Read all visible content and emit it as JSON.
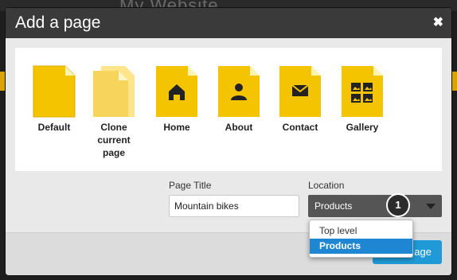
{
  "background": {
    "text": "My Website"
  },
  "modal": {
    "title": "Add a page",
    "close_icon": "close-icon"
  },
  "templates": [
    {
      "label": "Default",
      "icon": "blank-page-icon"
    },
    {
      "label": "Clone current page",
      "label_lines": [
        "Clone",
        "current",
        "page"
      ],
      "icon": "clone-page-icon"
    },
    {
      "label": "Home",
      "icon": "home-icon"
    },
    {
      "label": "About",
      "icon": "person-icon"
    },
    {
      "label": "Contact",
      "icon": "envelope-icon"
    },
    {
      "label": "Gallery",
      "icon": "gallery-icon"
    }
  ],
  "form": {
    "page_title_label": "Page Title",
    "page_title_value": "Mountain bikes",
    "location_label": "Location",
    "location_value": "Products",
    "location_options": [
      "Top level",
      "Products"
    ],
    "selected_option": "Products",
    "step_badge": "1"
  },
  "footer": {
    "add_button_label": "Add page",
    "add_button_visible": "age"
  },
  "colors": {
    "template_yellow": "#f5c400",
    "accent_blue": "#1f9ad6",
    "header": "#3a3a3a"
  }
}
